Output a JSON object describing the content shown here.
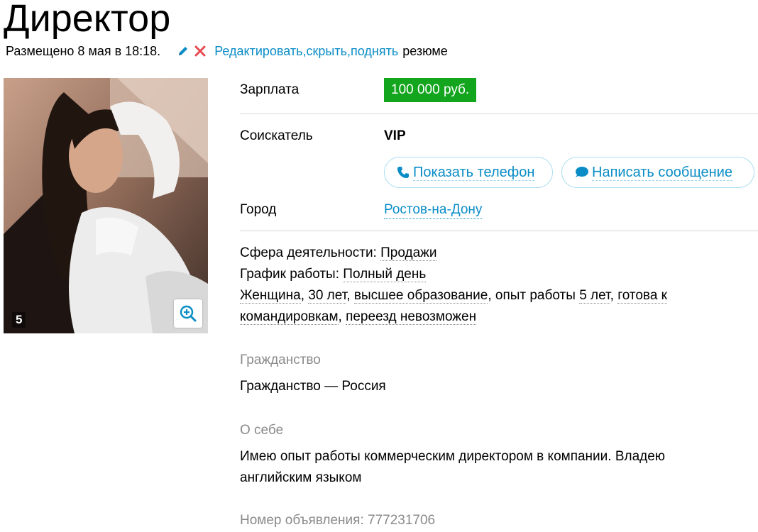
{
  "title": "Директор",
  "meta": {
    "posted": "Размещено 8 мая в 18:18.",
    "edit_link": "Редактировать",
    "hide_link": "скрыть",
    "raise_link": "поднять",
    "suffix": "резюме",
    "sep1": ", ",
    "sep2": ", "
  },
  "photo": {
    "count": "5"
  },
  "details": {
    "salary_label": "Зарплата",
    "salary_value": "100 000 руб.",
    "applicant_label": "Соискатель",
    "applicant_value": "VIP",
    "show_phone": "Показать телефон",
    "write_message": "Написать сообщение",
    "city_label": "Город",
    "city_value": "Ростов-на-Дону"
  },
  "info": {
    "sphere_label": "Сфера деятельности:",
    "sphere_value": "Продажи",
    "schedule_label": "График работы:",
    "schedule_value": "Полный день",
    "gender": "Женщина",
    "age": "30 лет",
    "education": "высшее образование",
    "experience_prefix": "опыт работы",
    "experience_value": "5 лет",
    "trips": "готова к командировкам",
    "relocation": "переезд невозможен"
  },
  "citizenship": {
    "title": "Гражданство",
    "value": "Гражданство — Россия"
  },
  "about": {
    "title": "О себе",
    "text": "Имею опыт работы коммерческим директором в компании. Владею английским языком"
  },
  "ad_number": "Номер объявления: 777231706",
  "colors": {
    "link": "#0a8dc6",
    "salary_badge": "#12a51d",
    "muted": "#8a8a8a"
  },
  "icons": [
    "pencil-icon",
    "close-icon",
    "phone-icon",
    "chat-bubble-icon",
    "zoom-in-icon"
  ]
}
